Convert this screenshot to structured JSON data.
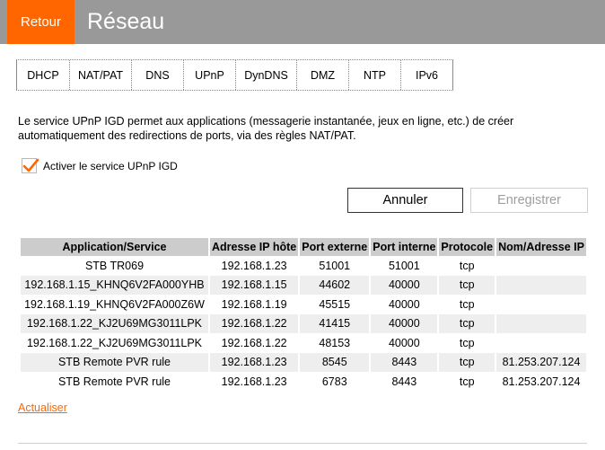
{
  "header": {
    "back_label": "Retour",
    "title": "Réseau"
  },
  "tabs": [
    {
      "label": "DHCP"
    },
    {
      "label": "NAT/PAT"
    },
    {
      "label": "DNS"
    },
    {
      "label": "UPnP",
      "active": true
    },
    {
      "label": "DynDNS"
    },
    {
      "label": "DMZ"
    },
    {
      "label": "NTP"
    },
    {
      "label": "IPv6"
    }
  ],
  "intro_text": "Le service UPnP IGD permet aux applications (messagerie instantanée, jeux en ligne, etc.) de créer automatiquement des redirections de ports, via des règles NAT/PAT.",
  "enable_checkbox": {
    "label": "Activer le service UPnP IGD",
    "checked": true
  },
  "buttons": {
    "cancel": "Annuler",
    "save": "Enregistrer"
  },
  "table": {
    "headers": [
      "Application/Service",
      "Adresse IP hôte",
      "Port externe",
      "Port interne",
      "Protocole",
      "Nom/Adresse IP"
    ],
    "rows": [
      [
        "STB TR069",
        "192.168.1.23",
        "51001",
        "51001",
        "tcp",
        ""
      ],
      [
        "192.168.1.15_KHNQ6V2FA000YHB",
        "192.168.1.15",
        "44602",
        "40000",
        "tcp",
        ""
      ],
      [
        "192.168.1.19_KHNQ6V2FA000Z6W",
        "192.168.1.19",
        "45515",
        "40000",
        "tcp",
        ""
      ],
      [
        "192.168.1.22_KJ2U69MG3011LPK",
        "192.168.1.22",
        "41415",
        "40000",
        "tcp",
        ""
      ],
      [
        "192.168.1.22_KJ2U69MG3011LPK",
        "192.168.1.22",
        "48153",
        "40000",
        "tcp",
        ""
      ],
      [
        "STB Remote PVR rule",
        "192.168.1.23",
        "8545",
        "8443",
        "tcp",
        "81.253.207.124"
      ],
      [
        "STB Remote PVR rule",
        "192.168.1.23",
        "6783",
        "8443",
        "tcp",
        "81.253.207.124"
      ]
    ]
  },
  "refresh_label": "Actualiser",
  "colors": {
    "accent": "#ff6600",
    "header_bg": "#999999",
    "table_header_bg": "#cccccc",
    "row_alt_bg": "#eeeeee"
  }
}
